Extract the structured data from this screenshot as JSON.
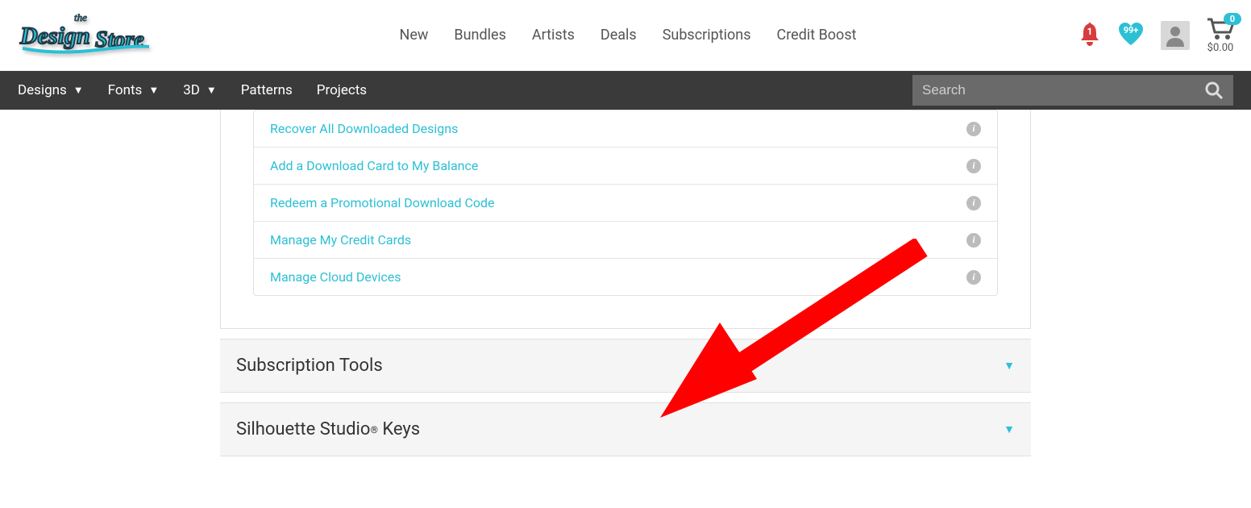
{
  "header": {
    "nav": [
      "New",
      "Bundles",
      "Artists",
      "Deals",
      "Subscriptions",
      "Credit Boost"
    ],
    "notifications": "1",
    "favorites": "99+",
    "cart_count": "0",
    "cart_total": "$0.00"
  },
  "navbar": {
    "items": [
      {
        "label": "Designs",
        "dropdown": true
      },
      {
        "label": "Fonts",
        "dropdown": true
      },
      {
        "label": "3D",
        "dropdown": true
      },
      {
        "label": "Patterns",
        "dropdown": false
      },
      {
        "label": "Projects",
        "dropdown": false
      }
    ],
    "search_placeholder": "Search"
  },
  "content": {
    "links": [
      "Recover All Downloaded Designs",
      "Add a Download Card to My Balance",
      "Redeem a Promotional Download Code",
      "Manage My Credit Cards",
      "Manage Cloud Devices"
    ],
    "accordions": [
      {
        "title": "Subscription Tools",
        "reg": false
      },
      {
        "title": "Silhouette Studio",
        "reg": true,
        "suffix": " Keys"
      }
    ]
  }
}
